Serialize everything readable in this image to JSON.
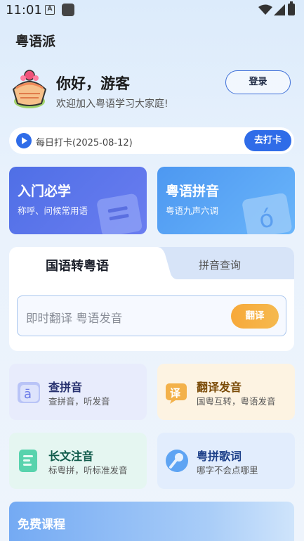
{
  "status_bar": {
    "time": "11:01",
    "notif_letter": "A"
  },
  "app": {
    "title": "粤语派"
  },
  "user": {
    "greeting": "你好，游客",
    "welcome": "欢迎加入粤语学习大家庭!",
    "login_label": "登录"
  },
  "checkin": {
    "text": "每日打卡(2025-08-12)",
    "button": "去打卡"
  },
  "big_cards": [
    {
      "title": "入门必学",
      "subtitle": "称呼、问候常用语",
      "icon": "book-icon"
    },
    {
      "title": "粤语拼音",
      "subtitle": "粤语九声六调",
      "icon": "pinyin-card-icon",
      "icon_glyph": "ó"
    }
  ],
  "translate": {
    "tab_active": "国语转粤语",
    "tab_inactive": "拼音查询",
    "placeholder": "即时翻译 粤语发音",
    "button": "翻译"
  },
  "features": [
    {
      "title": "查拼音",
      "subtitle": "查拼音，听发音",
      "icon": "pinyin-icon",
      "glyph": "ā"
    },
    {
      "title": "翻译发音",
      "subtitle": "国粤互转，粤语发音",
      "icon": "translate-icon",
      "glyph": "译"
    },
    {
      "title": "长文注音",
      "subtitle": "标粤拼，听标准发音",
      "icon": "document-icon"
    },
    {
      "title": "粤拼歌词",
      "subtitle": "哪字不会点哪里",
      "icon": "microphone-icon"
    }
  ],
  "courses": {
    "title": "免费课程"
  },
  "colors": {
    "primary": "#2f6ce8",
    "accent": "#f7a93a",
    "card_left": "#4f6fe6",
    "card_right": "#4d98f1"
  }
}
